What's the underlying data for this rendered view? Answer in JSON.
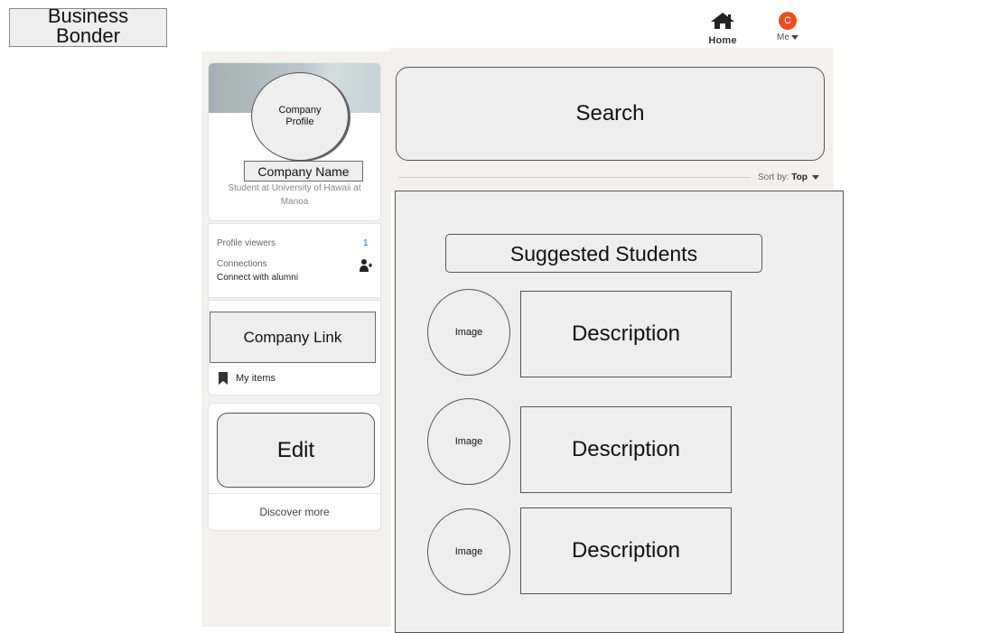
{
  "brand": {
    "line1": "Business",
    "line2": "Bonder"
  },
  "nav": {
    "home_label": "Home",
    "me_label": "Me",
    "avatar_initial": "C"
  },
  "profile": {
    "company_profile_l1": "Company",
    "company_profile_l2": "Profile",
    "company_name": "Company Name",
    "subtitle": "Student at University of Hawaii at Manoa"
  },
  "stats": {
    "profile_viewers_label": "Profile viewers",
    "profile_viewers_count": "1",
    "connections_label": "Connections",
    "connections_sub": "Connect with alumni"
  },
  "links": {
    "company_link": "Company Link",
    "my_items": "My items"
  },
  "actions": {
    "edit": "Edit",
    "discover_more": "Discover more"
  },
  "main": {
    "search": "Search",
    "sort_prefix": "Sort by:",
    "sort_value": "Top",
    "suggested_title": "Suggested Students",
    "students": [
      {
        "image": "Image",
        "description": "Description"
      },
      {
        "image": "Image",
        "description": "Description"
      },
      {
        "image": "Image",
        "description": "Description"
      }
    ]
  },
  "colors": {
    "avatar": "#e8501e",
    "viewers_count": "#2a6db0"
  },
  "icons": [
    "home-icon",
    "caret-down-icon",
    "add-person-icon",
    "bookmark-icon"
  ]
}
